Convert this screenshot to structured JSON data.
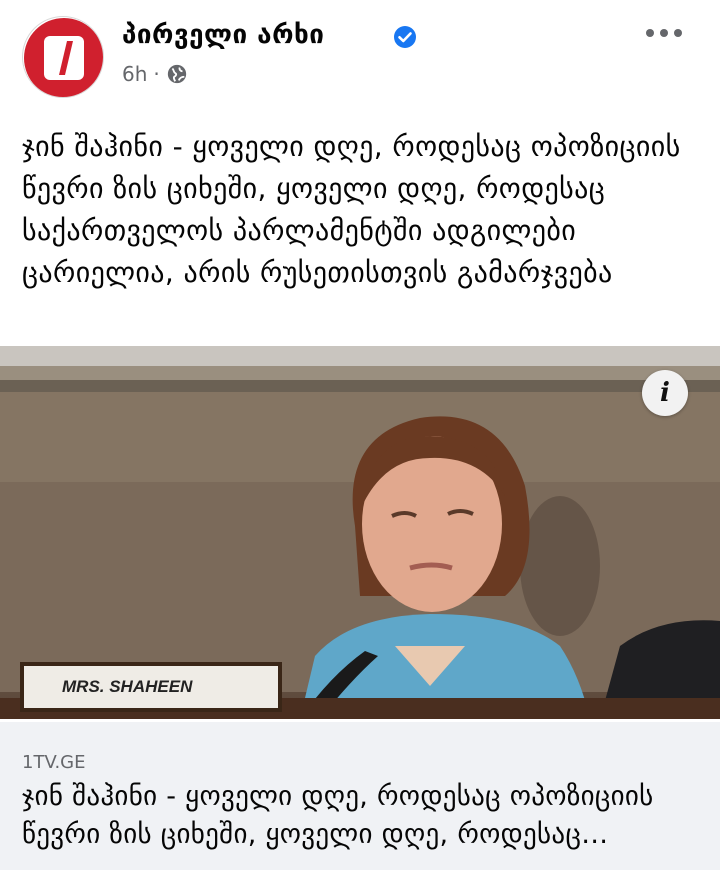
{
  "post": {
    "page_name": "პირველი არხი",
    "verified_icon": "verified-badge-icon",
    "time": "6h",
    "separator": "·",
    "audience_icon": "globe-icon",
    "more_icon": "more-options-icon",
    "text": "ჯინ შაჰინი - ყოველი დღე, როდესაც ოპოზიციის წევრი ზის ციხეში, ყოველი დღე, როდესაც საქართველოს პარლამენტში ადგილები ცარიელია, არის რუსეთისთვის გამარჯვება"
  },
  "photo": {
    "nameplate": "MRS. SHAHEEN",
    "info_button_label": "i"
  },
  "link": {
    "domain": "1TV.GE",
    "title": "ჯინ შაჰინი - ყოველი დღე, როდესაც ოპოზიციის წევრი ზის ციხეში, ყოველი დღე, როდესაც საქართველოს პარლამენტში ადგილები ცარიელია, არის რუსეთისთვის გამარჯვება"
  },
  "colors": {
    "brand_red": "#d0202e",
    "verified_blue": "#1877f2",
    "meta_gray": "#65676b",
    "link_bg": "#f0f2f5"
  }
}
